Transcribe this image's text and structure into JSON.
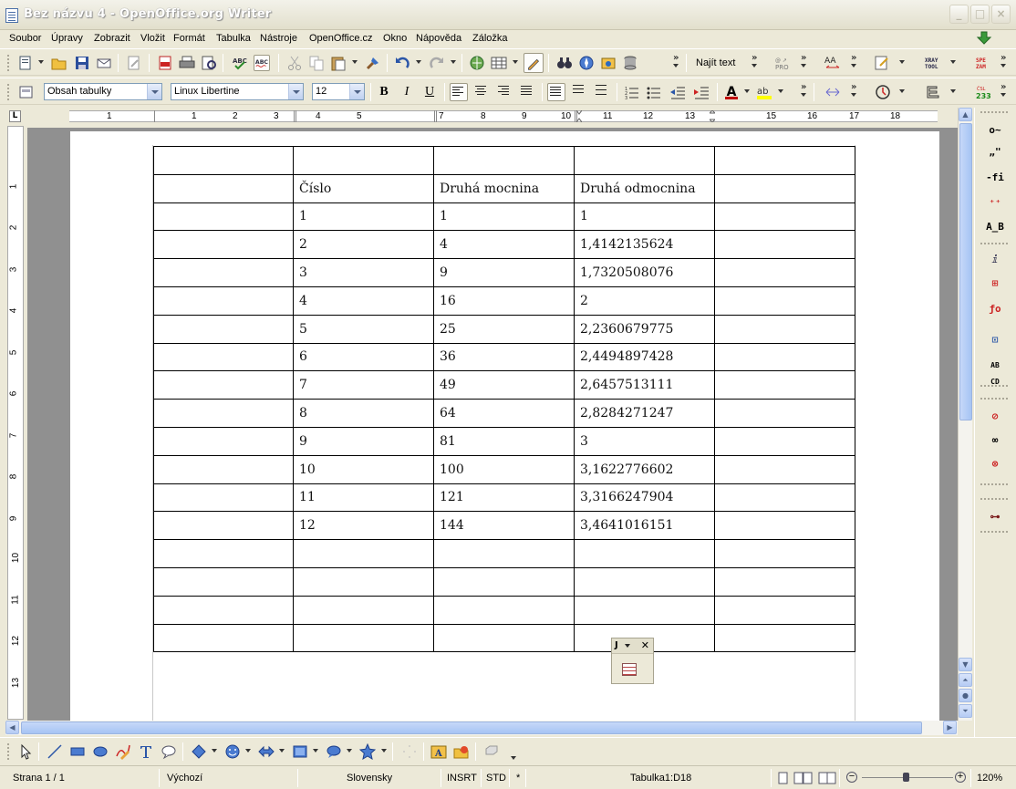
{
  "window": {
    "title": "Bez názvu 4 - OpenOffice.org Writer"
  },
  "menu": [
    "Soubor",
    "Úpravy",
    "Zobrazit",
    "Vložit",
    "Formát",
    "Tabulka",
    "Nástroje",
    "OpenOffice.cz",
    "Okno",
    "Nápověda",
    "Záložka"
  ],
  "standard_toolbar": {
    "find_label": "Najít text"
  },
  "format_toolbar": {
    "paragraph_style": "Obsah tabulky",
    "font_name": "Linux Libertine",
    "font_size": "12"
  },
  "ruler": {
    "h_numbers": [
      "1",
      "1",
      "2",
      "3",
      "4",
      "5",
      "7",
      "8",
      "9",
      "10",
      "11",
      "12",
      "13",
      "15",
      "16",
      "17",
      "18"
    ],
    "v_numbers": [
      "1",
      "2",
      "3",
      "4",
      "5",
      "6",
      "7",
      "8",
      "9",
      "10",
      "11",
      "12",
      "13"
    ]
  },
  "table": {
    "rows": [
      [
        "",
        "",
        "",
        "",
        ""
      ],
      [
        "",
        "Číslo",
        "Druhá mocnina",
        "Druhá odmocnina",
        ""
      ],
      [
        "",
        "1",
        "1",
        "1",
        ""
      ],
      [
        "",
        "2",
        "4",
        "1,4142135624",
        ""
      ],
      [
        "",
        "3",
        "9",
        "1,7320508076",
        ""
      ],
      [
        "",
        "4",
        "16",
        "2",
        ""
      ],
      [
        "",
        "5",
        "25",
        "2,2360679775",
        ""
      ],
      [
        "",
        "6",
        "36",
        "2,4494897428",
        ""
      ],
      [
        "",
        "7",
        "49",
        "2,6457513111",
        ""
      ],
      [
        "",
        "8",
        "64",
        "2,8284271247",
        ""
      ],
      [
        "",
        "9",
        "81",
        "3",
        ""
      ],
      [
        "",
        "10",
        "100",
        "3,1622776602",
        ""
      ],
      [
        "",
        "11",
        "121",
        "3,3166247904",
        ""
      ],
      [
        "",
        "12",
        "144",
        "3,4641016151",
        ""
      ],
      [
        "",
        "",
        "",
        "",
        ""
      ],
      [
        "",
        "",
        "",
        "",
        ""
      ],
      [
        "",
        "",
        "",
        "",
        ""
      ],
      [
        "",
        "",
        "",
        "",
        ""
      ]
    ]
  },
  "floating_toolbar": {
    "title": "J"
  },
  "sidebar_labels": {
    "xray": "XRAY TOOL",
    "spezam": "SPE ZAM",
    "cisla": "233"
  },
  "status": {
    "page": "Strana 1 / 1",
    "style": "Výchozí",
    "language": "Slovensky",
    "insert_mode": "INSRT",
    "selection_mode": "STD",
    "modified": "*",
    "cell": "Tabulka1:D18",
    "zoom": "120%"
  },
  "colors": {
    "font_color": "#c00000",
    "highlight": "#ffff00",
    "accent": "#316ac5"
  }
}
